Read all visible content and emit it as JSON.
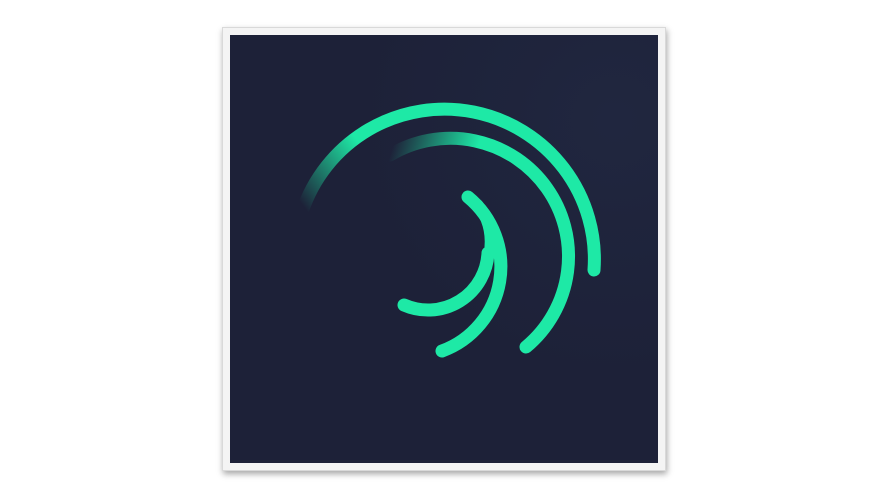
{
  "app_icon": {
    "name": "swirl-logo",
    "background_color": "#1d2138",
    "accent_color": "#1ee9a6",
    "frame_color": "#f4f4f4"
  }
}
